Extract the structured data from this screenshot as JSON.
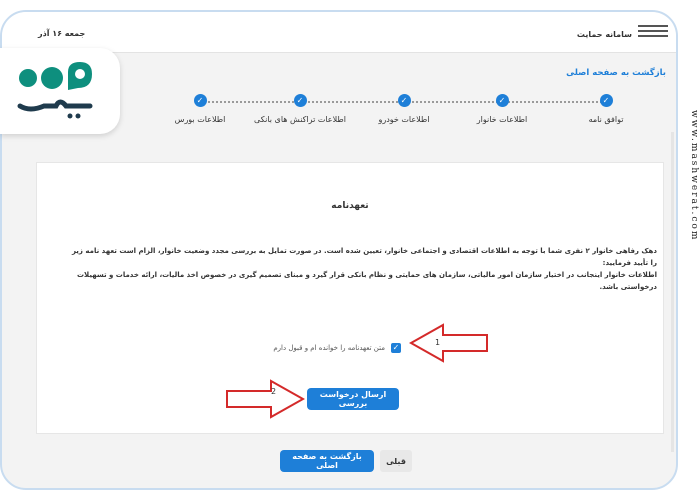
{
  "header": {
    "system_title": "سامانه حمایت",
    "date": "جمعه ۱۶ آذر",
    "back_link": "بازگشت به صفحه اصلی"
  },
  "stepper": {
    "steps": [
      {
        "label": "توافق نامه"
      },
      {
        "label": "اطلاعات خانوار"
      },
      {
        "label": "اطلاعات خودرو"
      },
      {
        "label": "اطلاعات تراکنش های بانکی"
      },
      {
        "label": "اطلاعات بورس"
      }
    ]
  },
  "agreement": {
    "title": "تعهدنامه",
    "paragraph_1": "دهک رفاهی خانوار ۲ نفری شما با توجه به اطلاعات اقتصادی و اجتماعی خانوار، تعیین شده است. در صورت تمایل به بررسی مجدد وضعیت خانوار، الزام است تعهد نامه زیر را تأیید فرمایید:",
    "paragraph_2": "اطلاعات خانوار اینجانب در اختیار سازمان امور مالیاتی، سازمان های حمایتی و نظام بانکی قرار گیرد و مبنای تصمیم گیری در خصوص اخذ مالیات، ارائه خدمات و تسهیلات درخواستی باشد.",
    "checkbox_label": "متن تعهدنامه را خوانده ام و قبول دارم",
    "submit_label": "ارسال درخواست بررسی"
  },
  "annotations": {
    "one": "1",
    "two": "2"
  },
  "footer": {
    "home_label": "بازگشت به صفحه اصلی",
    "prev_label": "قبلی"
  },
  "watermark": {
    "site": "www.mashwerat.com"
  },
  "colors": {
    "accent": "#1e7fd8",
    "arrow": "#d42a2a"
  }
}
